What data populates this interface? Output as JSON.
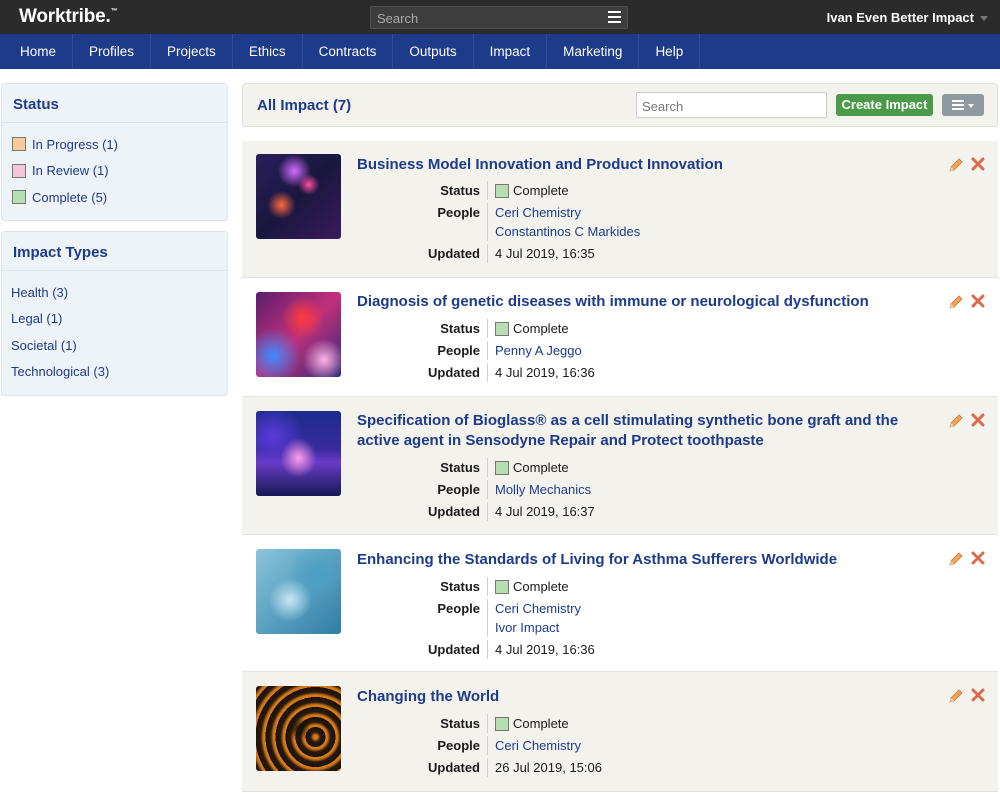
{
  "topbar": {
    "logo": "Worktribe.",
    "logo_tm": "™",
    "search_placeholder": "Search",
    "user_name": "Ivan Even Better Impact"
  },
  "nav": {
    "items": [
      "Home",
      "Profiles",
      "Projects",
      "Ethics",
      "Contracts",
      "Outputs",
      "Impact",
      "Marketing",
      "Help"
    ]
  },
  "sidebar": {
    "status": {
      "title": "Status",
      "items": [
        {
          "label": "In Progress (1)",
          "color": "#f8c99a"
        },
        {
          "label": "In Review (1)",
          "color": "#f4c6da"
        },
        {
          "label": "Complete (5)",
          "color": "#b6deb0"
        }
      ]
    },
    "impact_types": {
      "title": "Impact Types",
      "items": [
        "Health (3)",
        "Legal (1)",
        "Societal (1)",
        "Technological (3)"
      ]
    }
  },
  "main": {
    "title": "All Impact (7)",
    "search_placeholder": "Search",
    "create_label": "Create Impact"
  },
  "labels": {
    "status": "Status",
    "people": "People",
    "updated": "Updated"
  },
  "records": [
    {
      "title": "Business Model Innovation and Product Innovation",
      "status": "Complete",
      "people": [
        "Ceri Chemistry",
        "Constantinos C Markides"
      ],
      "updated": "4 Jul 2019, 16:35"
    },
    {
      "title": "Diagnosis of genetic diseases with immune or neurological dysfunction",
      "status": "Complete",
      "people": [
        "Penny A Jeggo"
      ],
      "updated": "4 Jul 2019, 16:36"
    },
    {
      "title": "Specification of Bioglass® as a cell stimulating synthetic bone graft and the active agent in Sensodyne Repair and Protect toothpaste",
      "status": "Complete",
      "people": [
        "Molly Mechanics"
      ],
      "updated": "4 Jul 2019, 16:37"
    },
    {
      "title": "Enhancing the Standards of Living for Asthma Sufferers Worldwide",
      "status": "Complete",
      "people": [
        "Ceri Chemistry",
        "Ivor Impact"
      ],
      "updated": "4 Jul 2019, 16:36"
    },
    {
      "title": "Changing the World",
      "status": "Complete",
      "people": [
        "Ceri Chemistry"
      ],
      "updated": "26 Jul 2019, 15:06"
    }
  ]
}
